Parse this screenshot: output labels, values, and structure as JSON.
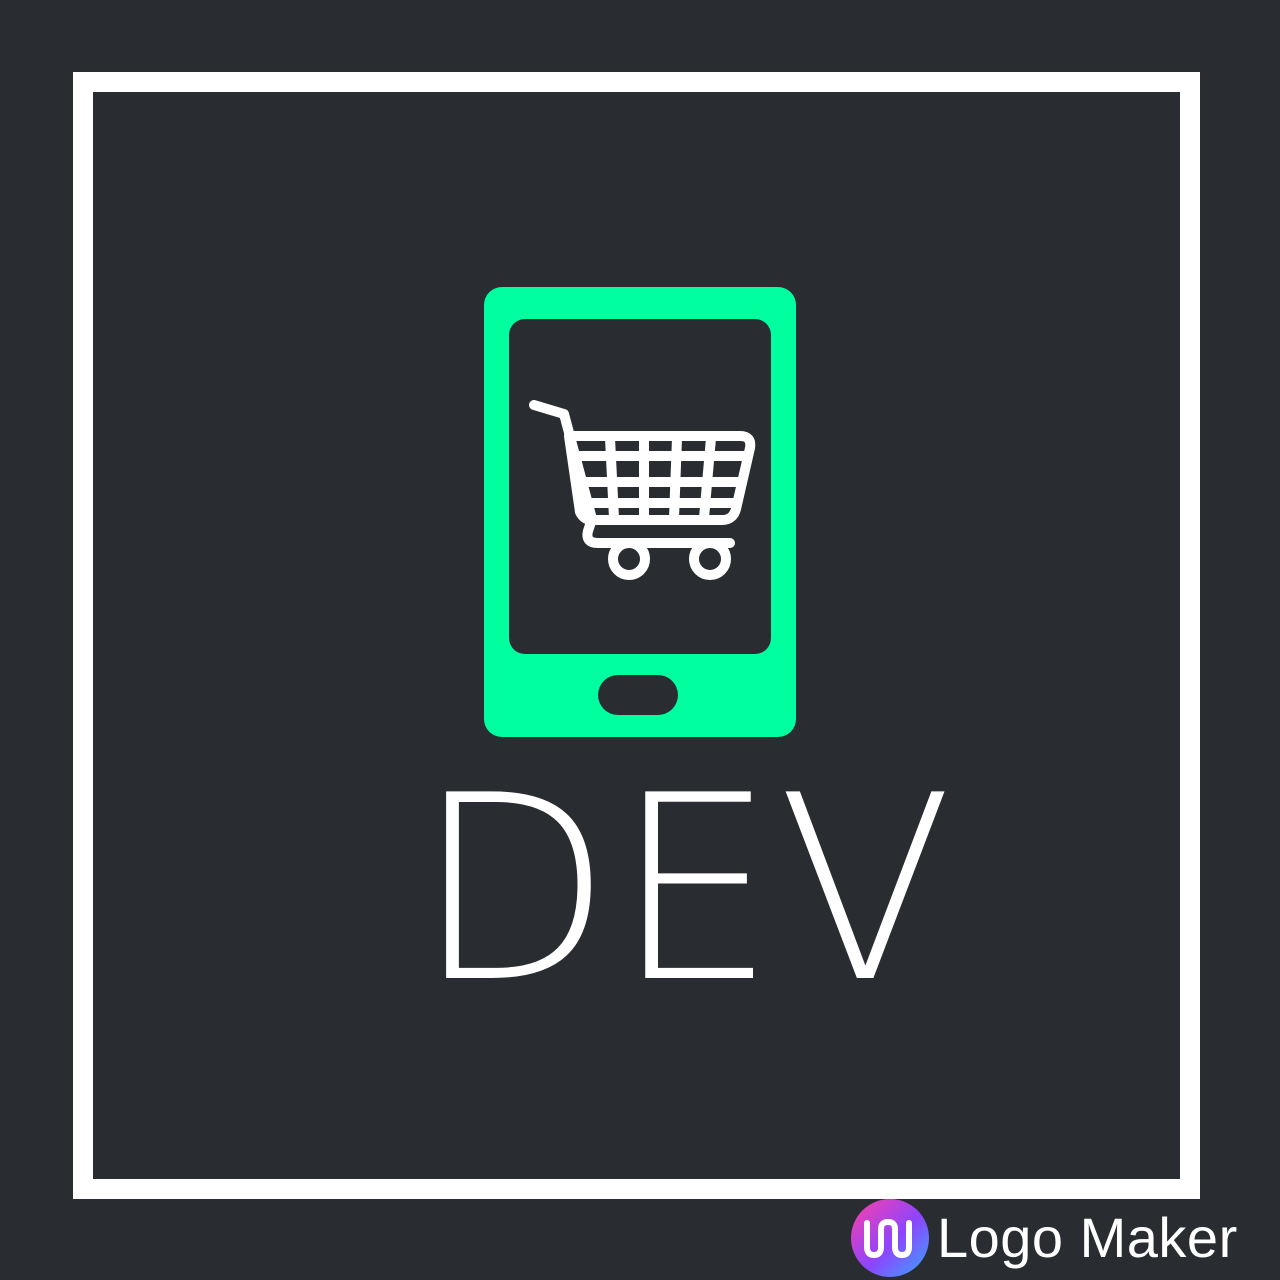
{
  "logo": {
    "brand_text": "DEV",
    "icon": "smartphone-shopping-cart-icon",
    "colors": {
      "background": "#292d32",
      "frame": "#ffffff",
      "phone": "#00ff9f",
      "screen": "#292d32",
      "cart": "#ffffff",
      "text": "#ffffff"
    }
  },
  "watermark": {
    "label": "Logo Maker",
    "icon": "logo-maker-app-icon",
    "gradient": [
      "#ff3fa4",
      "#8c45ff",
      "#35a8ff"
    ]
  }
}
